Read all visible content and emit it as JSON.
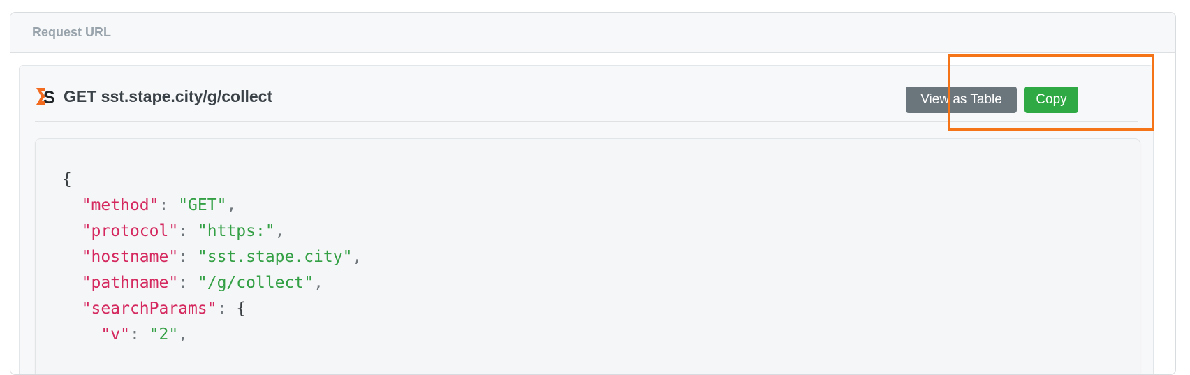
{
  "section_title": "Request URL",
  "request": {
    "title": "GET sst.stape.city/g/collect",
    "logo_icon": "stape-logo-icon"
  },
  "buttons": {
    "view_as_table": "View as Table",
    "copy": "Copy"
  },
  "colors": {
    "highlight": "#f57418",
    "copy_button": "#2ea944",
    "view_table_button": "#6b757c",
    "json_key": "#d4285f",
    "json_string": "#34a046"
  },
  "json": {
    "open_brace": "{",
    "lines": [
      {
        "key": "\"method\"",
        "value": "\"GET\"",
        "suffix": ","
      },
      {
        "key": "\"protocol\"",
        "value": "\"https:\"",
        "suffix": ","
      },
      {
        "key": "\"hostname\"",
        "value": "\"sst.stape.city\"",
        "suffix": ","
      },
      {
        "key": "\"pathname\"",
        "value": "\"/g/collect\"",
        "suffix": ","
      },
      {
        "key": "\"searchParams\"",
        "value": "{",
        "suffix": ""
      },
      {
        "key": "\"v\"",
        "value": "\"2\"",
        "suffix": ","
      }
    ]
  }
}
